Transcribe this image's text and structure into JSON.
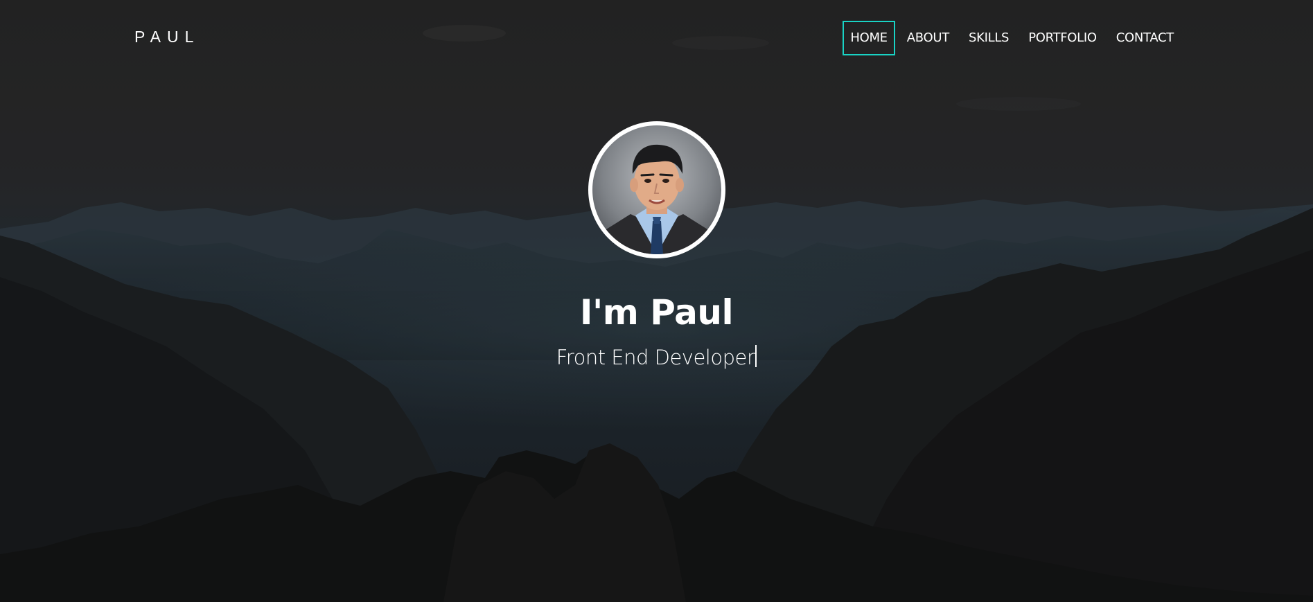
{
  "brand": {
    "name": "PAUL"
  },
  "nav": {
    "items": [
      {
        "label": "HOME",
        "active": true
      },
      {
        "label": "ABOUT",
        "active": false
      },
      {
        "label": "SKILLS",
        "active": false
      },
      {
        "label": "PORTFOLIO",
        "active": false
      },
      {
        "label": "CONTACT",
        "active": false
      }
    ]
  },
  "hero": {
    "title": "I'm Paul",
    "subtitle": "Front End Developer"
  },
  "colors": {
    "accent": "#19d3c5",
    "text": "#ffffff",
    "overlay": "#1f2326"
  }
}
